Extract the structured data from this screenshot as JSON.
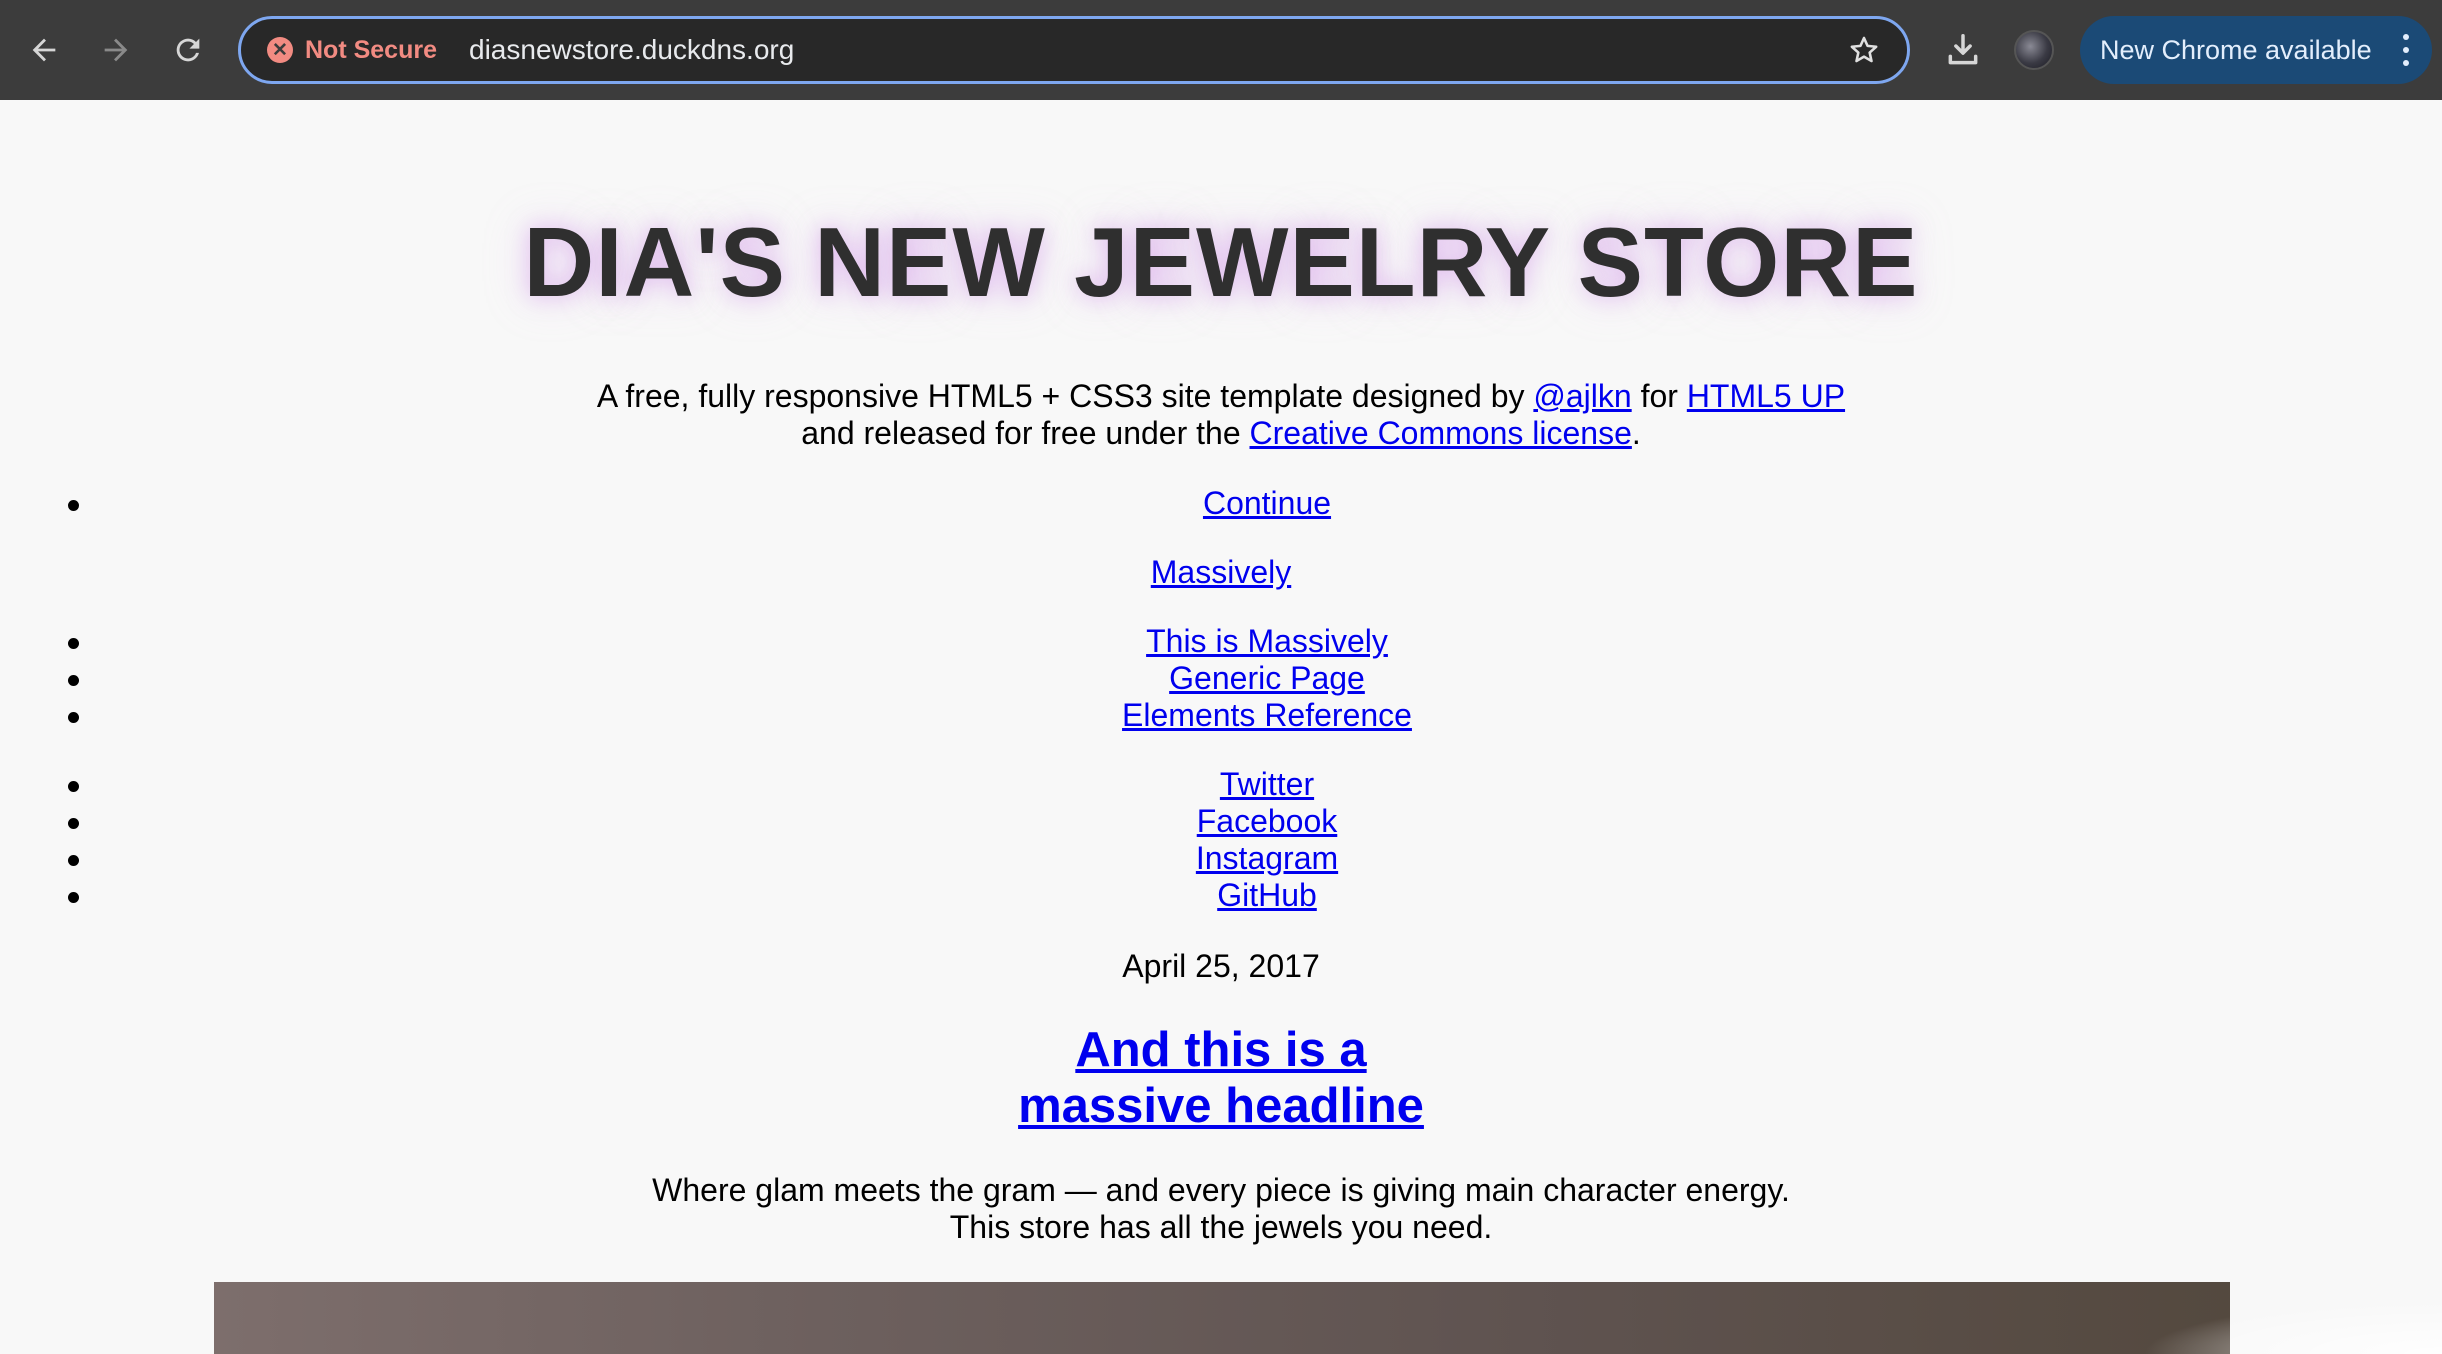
{
  "browser": {
    "security_label": "Not Secure",
    "url": "diasnewstore.duckdns.org",
    "update_label": "New Chrome available",
    "icons": [
      "back-arrow-icon",
      "forward-arrow-icon",
      "reload-icon",
      "warning-icon",
      "star-icon",
      "download-icon",
      "avatar",
      "kebab-menu-icon"
    ]
  },
  "page": {
    "title": "DIA'S NEW JEWELRY STORE",
    "intro": {
      "part1": "A free, fully responsive HTML5 + CSS3 site template designed by ",
      "link_author": "@ajlkn",
      "part2": " for ",
      "link_html5up": "HTML5 UP",
      "part3": "and released for free under the ",
      "link_license": "Creative Commons license",
      "part4": "."
    },
    "nav": {
      "continue": "Continue",
      "logo": "Massively",
      "links": [
        "This is Massively",
        "Generic Page",
        "Elements Reference"
      ],
      "social": [
        "Twitter",
        "Facebook",
        "Instagram",
        "GitHub"
      ]
    },
    "post": {
      "date": "April 25, 2017",
      "headline_line1": "And this is a",
      "headline_line2": "massive headline",
      "tagline_line1": "Where glam meets the gram — and every piece is giving main character energy.",
      "tagline_line2": "This store has all the jewels you need."
    },
    "colors": {
      "link": "#0000ee",
      "title": "#2f2f2f",
      "title_glow": "#cd8ce6",
      "background": "#f8f8f8",
      "toolbar": "#3c3c3c",
      "omnibox_border": "#7ea7f0",
      "update_chip": "#1b4a76"
    }
  }
}
